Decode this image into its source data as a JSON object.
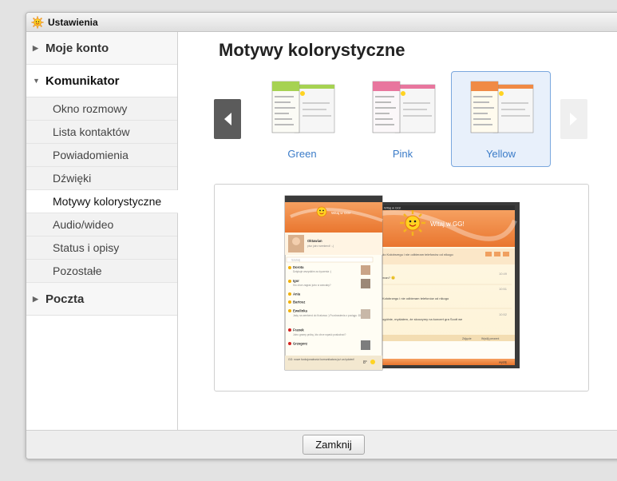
{
  "window": {
    "title": "Ustawienia"
  },
  "sidebar": {
    "sections": [
      {
        "label": "Moje konto",
        "expanded": false
      },
      {
        "label": "Komunikator",
        "expanded": true,
        "items": [
          "Okno rozmowy",
          "Lista kontaktów",
          "Powiadomienia",
          "Dźwięki",
          "Motywy kolorystyczne",
          "Audio/wideo",
          "Status i opisy",
          "Pozostałe"
        ],
        "active_item": "Motywy kolorystyczne"
      },
      {
        "label": "Poczta",
        "expanded": false
      }
    ]
  },
  "main": {
    "title": "Motywy kolorystyczne",
    "themes": [
      {
        "label": "Green",
        "color": "#a6d252",
        "selected": false
      },
      {
        "label": "Pink",
        "color": "#e8769e",
        "selected": false
      },
      {
        "label": "Yellow",
        "color": "#f08a45",
        "selected": true
      }
    ],
    "preview": {
      "title": "Witaj w GG!",
      "header": "Witaj w GG!",
      "search_placeholder": "Szukaj",
      "contacts": [
        {
          "name": "Oktawian",
          "desc": "pisz jutro weekend! :-)"
        },
        {
          "name": "Dorota",
          "desc": "Dziękuje wszystkim za życzenia :)"
        },
        {
          "name": "Igor",
          "desc": "Kto chce zagrać jutro w warcaby?"
        },
        {
          "name": "Ania",
          "desc": ""
        },
        {
          "name": "Bartosz",
          "desc": ""
        },
        {
          "name": "Ewelinka",
          "desc": "Jadę na weekend do Krakowa :) Pozdrowienia z pociągu :DDD"
        },
        {
          "name": "Franek",
          "desc": "Jutro gramy próbę, kto chce wpaść posłuchać?"
        },
        {
          "name": "Grzegorz",
          "desc": ""
        }
      ],
      "notice": "GG: nowe funkcjonalności komunikatora już za tydzień!",
      "weather": "8°",
      "chat_lines": [
        "do Kołobrzegu i nie odbieram telefonów od nikogo",
        "man? 🙂",
        "Kołobrzegu i nie odbieram telefonów od nikogo",
        "ogólnie, myślałem, że skoczymy na koncert gra Scott we"
      ],
      "times": [
        "10:49",
        "10:51",
        "10:52"
      ],
      "send_label": "wyślij",
      "footer_links": [
        "Zdjęcie",
        "Wyślij prezent"
      ]
    }
  },
  "footer": {
    "close_label": "Zamknij"
  },
  "colors": {
    "accent": "#3a7bc8",
    "orange": "#f08a45",
    "selection": "#e8f0fb"
  }
}
